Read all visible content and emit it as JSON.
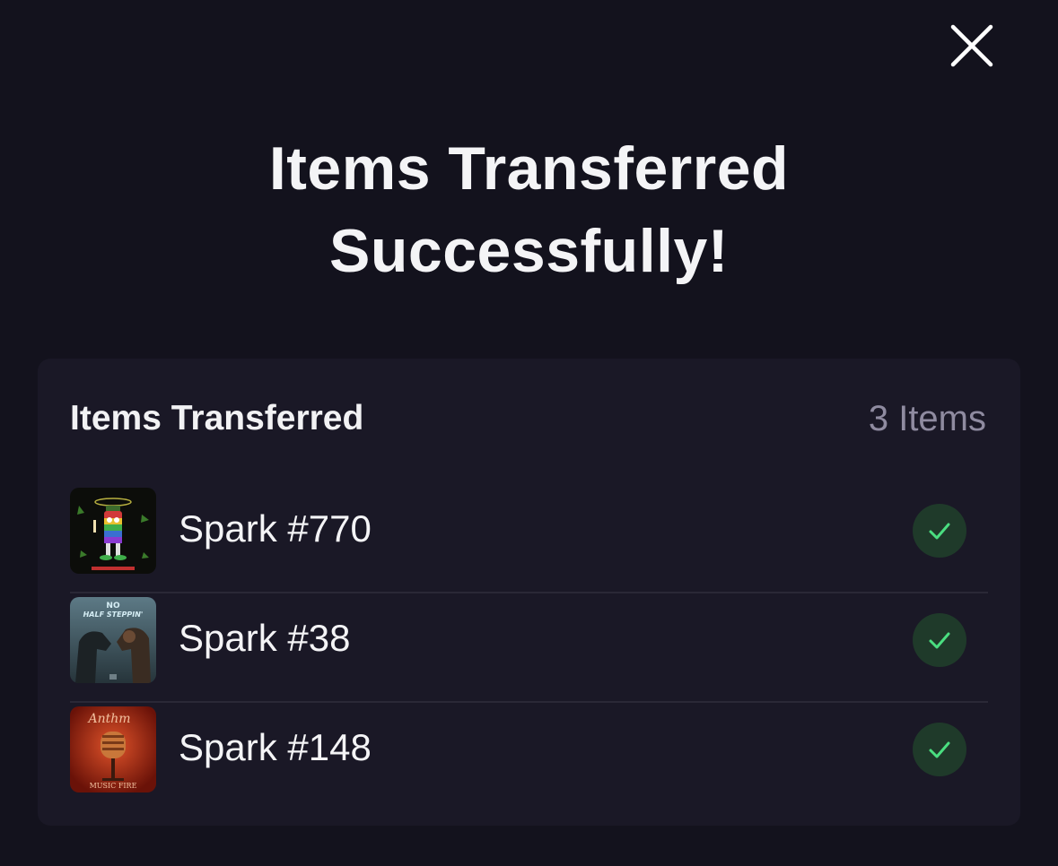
{
  "modal": {
    "title_line1": "Items Transferred",
    "title_line2": "Successfully!",
    "close_icon": "close-icon"
  },
  "card": {
    "title": "Items Transferred",
    "count": "3 Items"
  },
  "items": [
    {
      "name": "Spark #770",
      "status": "check-icon"
    },
    {
      "name": "Spark #38",
      "status": "check-icon"
    },
    {
      "name": "Spark #148",
      "status": "check-icon"
    }
  ],
  "colors": {
    "background": "#13121d",
    "card": "#1a1826",
    "check_bg": "#1f3a2a",
    "check_mark": "#4ade80",
    "muted_text": "#8f8ba0"
  }
}
